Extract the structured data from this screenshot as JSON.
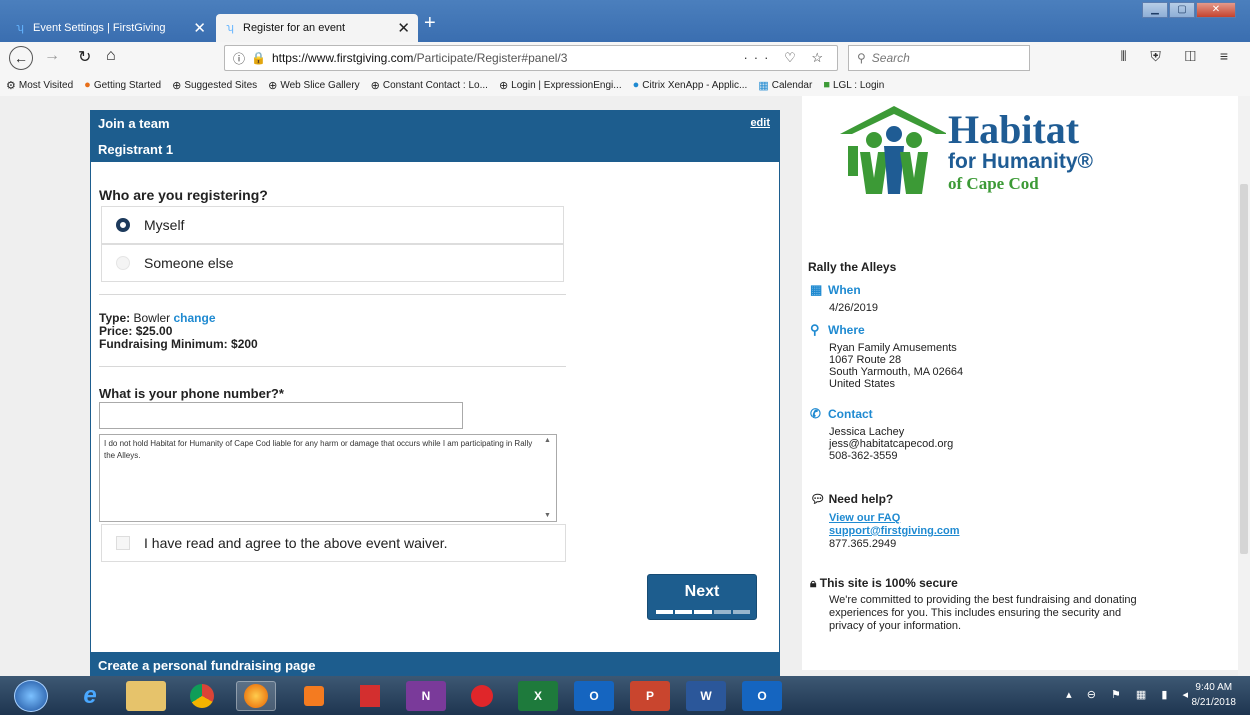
{
  "browser": {
    "tabs": [
      {
        "title": "Event Settings | FirstGiving"
      },
      {
        "title": "Register for an event"
      }
    ],
    "url_host": "https://www.firstgiving.com",
    "url_path": "/Participate/Register#panel/3",
    "url_tools": "··· ♡ ☆",
    "search_placeholder": "Search",
    "bookmarks": [
      "Most Visited",
      "Getting Started",
      "Suggested Sites",
      "Web Slice Gallery",
      "Constant Contact : Lo...",
      "Login | ExpressionEngi...",
      "Citrix XenApp - Applic...",
      "Calendar",
      "LGL : Login"
    ]
  },
  "form": {
    "join_team": "Join a team",
    "edit": "edit",
    "registrant": "Registrant 1",
    "who_heading": "Who are you registering?",
    "option_myself": "Myself",
    "option_someone": "Someone else",
    "type_label": "Type:",
    "type_value": "Bowler",
    "type_change": "change",
    "price_label": "Price:",
    "price_value": "$25.00",
    "min_label": "Fundraising Minimum:",
    "min_value": "$200",
    "phone_label": "What is your phone number?*",
    "phone_value": "",
    "waiver_text": "I do not hold Habitat for Humanity of Cape Cod liable for any harm or damage that occurs while I am participating in Rally the Alleys.",
    "agree_label": "I have read and agree to the above event waiver.",
    "next_label": "Next",
    "progress_steps_done": 3,
    "progress_steps_total": 5,
    "create_page": "Create a personal fundraising page"
  },
  "sidebar": {
    "logo_line1": "Habitat",
    "logo_line2": "for Humanity®",
    "logo_line3": "of Cape Cod",
    "event_title": "Rally the Alleys",
    "when_label": "When",
    "when_date": "4/26/2019",
    "where_label": "Where",
    "where_lines": [
      "Ryan Family Amusements",
      "1067 Route 28",
      "South Yarmouth, MA 02664",
      "United States"
    ],
    "contact_label": "Contact",
    "contact_lines": [
      "Jessica Lachey",
      "jess@habitatcapecod.org",
      "508-362-3559"
    ],
    "help_label": "Need help?",
    "help_faq": "View our FAQ",
    "help_email": "support@firstgiving.com",
    "help_phone": "877.365.2949",
    "secure_label": "This site is 100% secure",
    "secure_text": "We're committed to providing the best fundraising and donating experiences for you. This includes ensuring the security and privacy of your information."
  },
  "taskbar": {
    "apps": [
      "e",
      "",
      "",
      "",
      "",
      "",
      "N",
      "",
      "X",
      "O",
      "P",
      "W",
      "O"
    ],
    "time": "9:40 AM",
    "date": "8/21/2018"
  },
  "colors": {
    "brand_blue": "#1d5d8e",
    "link_blue": "#1f8ad1",
    "habitat_blue": "#1f5c94",
    "habitat_green": "#3c9a36"
  }
}
